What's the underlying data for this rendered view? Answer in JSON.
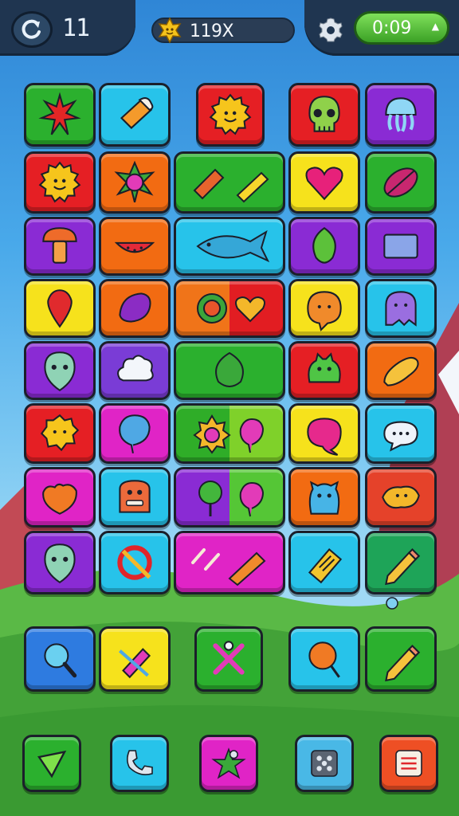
{
  "hud": {
    "level": "11",
    "score": "119X",
    "timer": "0:09",
    "back_icon": "refresh-icon",
    "settings_icon": "gear-icon",
    "coin_icon": "coin-star-icon"
  },
  "colors": {
    "green": "#2bb02e",
    "cyan": "#27c3ea",
    "red": "#e51f24",
    "purple": "#8a2bd4",
    "orange": "#f26b12",
    "yellow": "#f6e21c",
    "magenta": "#e024c6",
    "hud_dark": "#1f3550",
    "timer_green": "#4dbb2c"
  },
  "board": [
    [
      "spiky-creature",
      "ice-cream",
      "sun-face",
      "skull",
      "jellyfish"
    ],
    [
      "sun-face",
      "flower",
      "candy-pair",
      "heart",
      "leaf"
    ],
    [
      "mushroom",
      "watermelon",
      "fish",
      "leaf",
      "rectangle"
    ],
    [
      "balloon",
      "plum",
      "flower-heart",
      "blob-face",
      "ghost"
    ],
    [
      "alien-head",
      "cloud",
      "leaf-big",
      "frog",
      "foot"
    ],
    [
      "sun-blob",
      "balloon",
      "sunflower-balloon",
      "speech-balloon",
      "speech-bubble"
    ],
    [
      "heart-blob",
      "monster-face",
      "lollipop-balloon",
      "jelly-monster",
      "blob-creature"
    ],
    [
      "alien-head",
      "no-sign",
      "pencils",
      "ticket",
      "pencil"
    ]
  ],
  "tray": [
    "magnifier",
    "candy",
    "crossed-sticks",
    "balloon-orange",
    "pencil"
  ],
  "toolbar": [
    "shape-tool-icon",
    "phone-icon",
    "star-creature-icon",
    "grid-icon",
    "menu-icon"
  ]
}
